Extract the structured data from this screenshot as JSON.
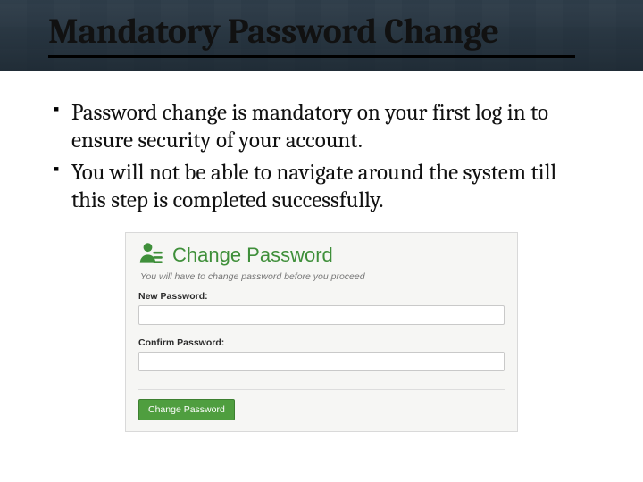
{
  "title": "Mandatory Password Change",
  "bullets": [
    "Password change is mandatory on your first log in to ensure security of your account.",
    "You will not be able to navigate around the system till this step is completed successfully."
  ],
  "panel": {
    "heading": "Change Password",
    "subtext": "You will have to change password before you proceed",
    "new_label": "New Password:",
    "confirm_label": "Confirm Password:",
    "button": "Change Password"
  }
}
